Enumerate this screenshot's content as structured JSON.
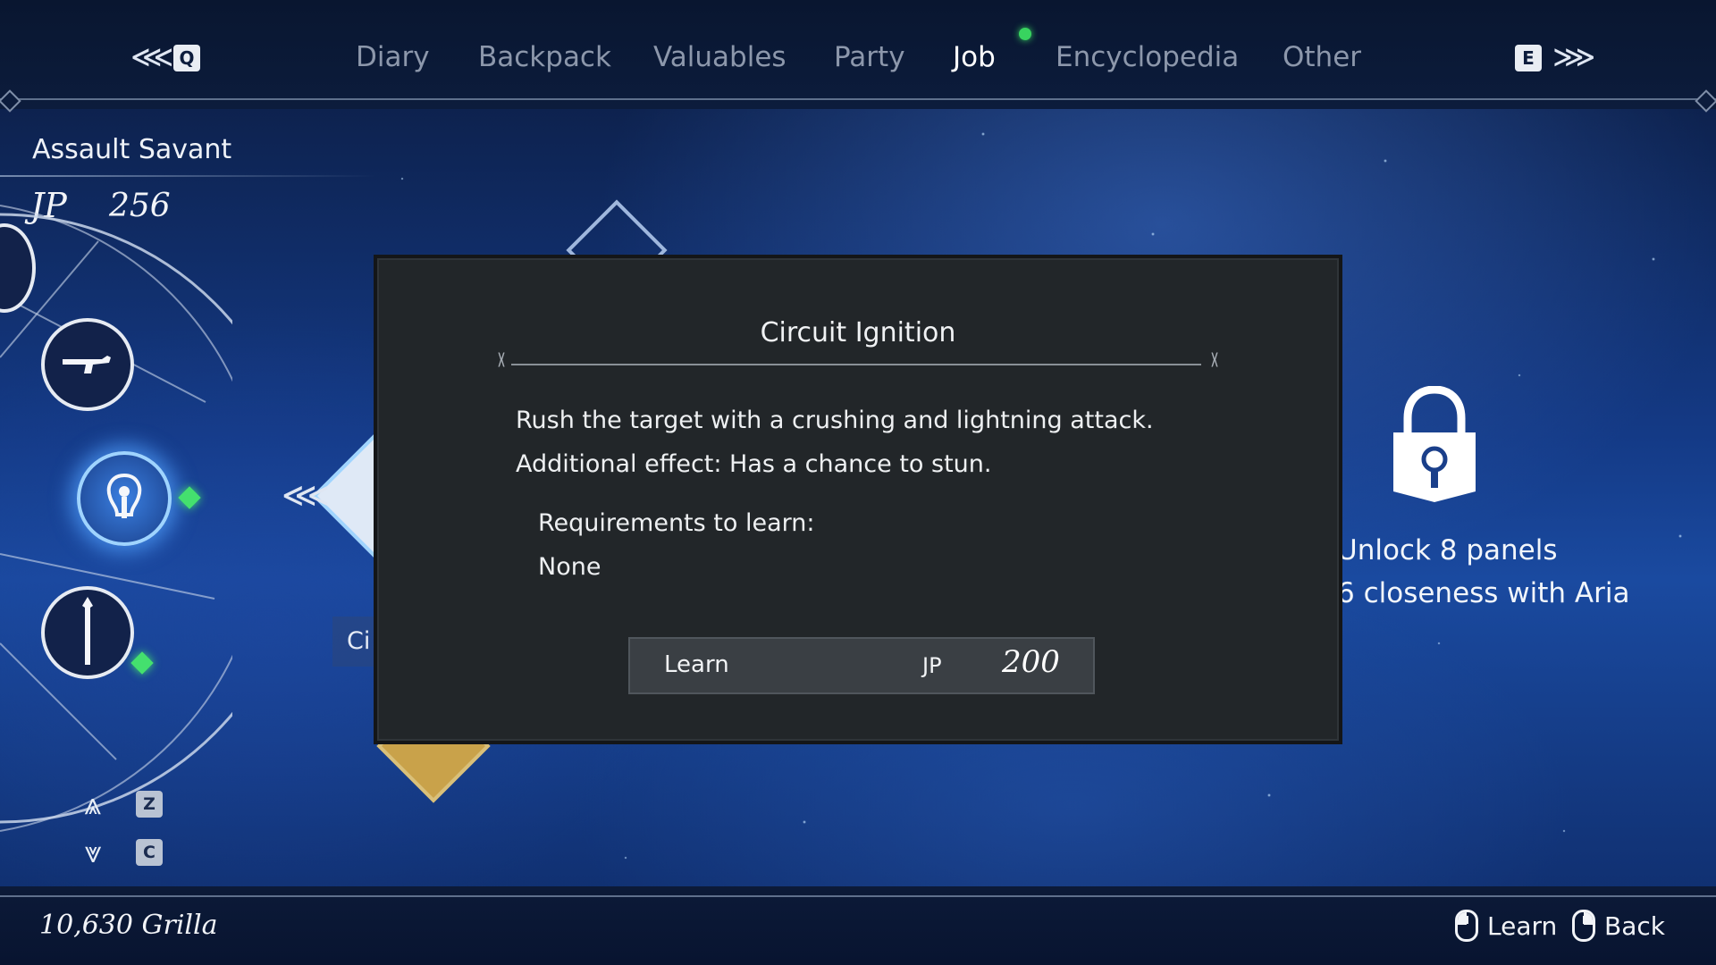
{
  "nav": {
    "prev_key": "Q",
    "next_key": "E",
    "tabs": [
      "Diary",
      "Backpack",
      "Valuables",
      "Party",
      "Job",
      "Encyclopedia",
      "Other"
    ],
    "active_tab": "Job"
  },
  "job": {
    "name": "Assault Savant",
    "jp_label": "JP",
    "jp_value": "256",
    "skill_icons": [
      "rifle-icon",
      "circuit-ignition-icon",
      "staff-icon"
    ],
    "side_keys": [
      "Z",
      "C"
    ]
  },
  "board": {
    "partial_label": "Ci",
    "locked": {
      "line1": "Unlock 8 panels",
      "line2": "6 closeness with Aria"
    }
  },
  "modal": {
    "title": "Circuit Ignition",
    "description": [
      "Rush the target with a crushing and lightning attack.",
      "Additional effect: Has a chance to stun."
    ],
    "requirements_label": "Requirements to learn:",
    "requirements_value": "None",
    "learn_label": "Learn",
    "cost_label": "JP",
    "cost_value": "200"
  },
  "footer": {
    "currency": "10,630 Grilla",
    "hints": [
      {
        "icon": "mouse-left-icon",
        "label": "Learn"
      },
      {
        "icon": "mouse-right-icon",
        "label": "Back"
      }
    ]
  },
  "colors": {
    "active_indicator": "#38d35f",
    "node_gem": "#44e06e",
    "modal_bg": "#222629"
  }
}
